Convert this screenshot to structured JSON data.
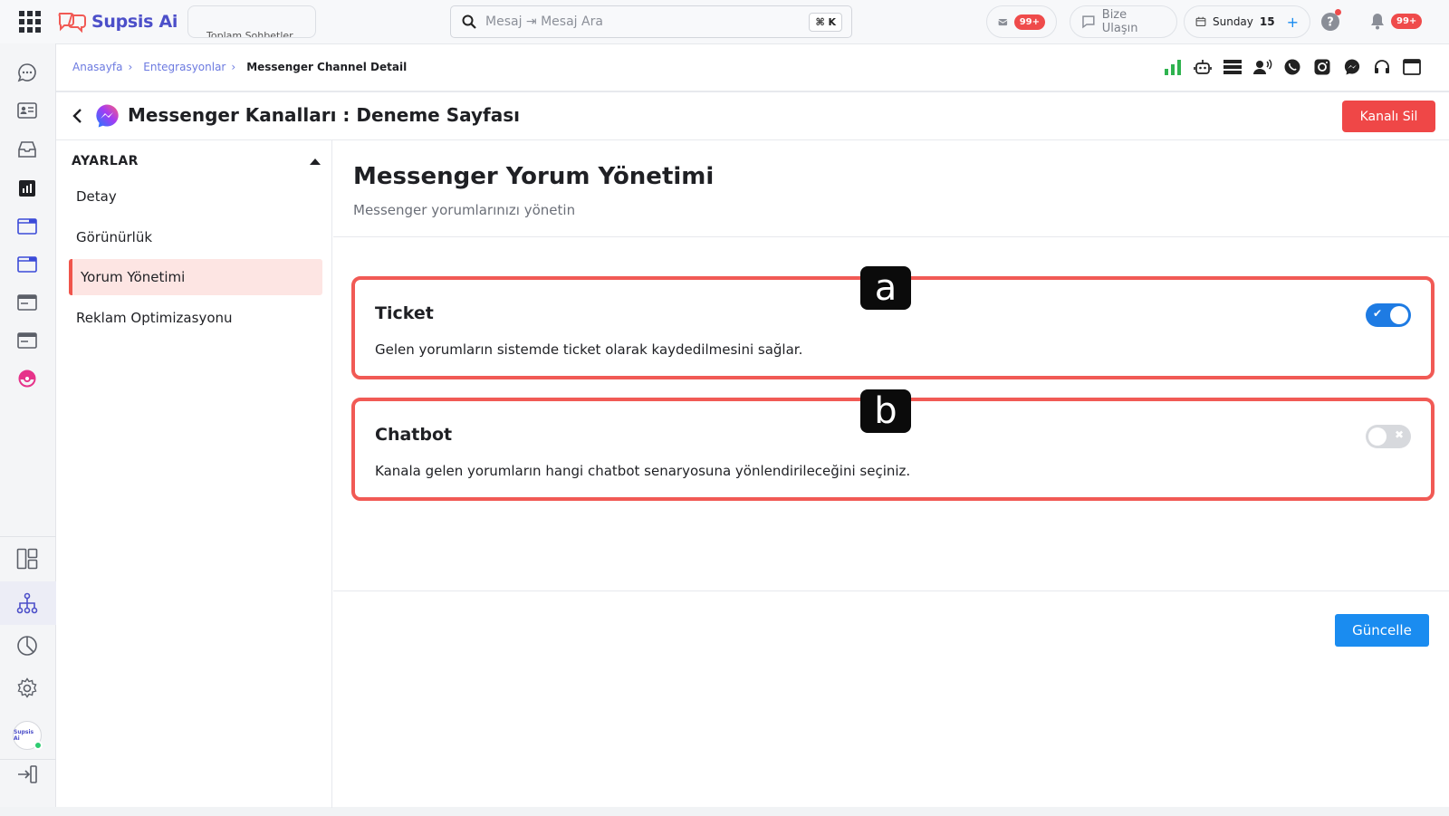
{
  "app": {
    "logo_text": "Supsis Ai"
  },
  "topbar": {
    "chats_label": "Toplam Sohbetler",
    "search_placeholder": "Mesaj ⇥ Mesaj Ara",
    "shortcut": "⌘ K",
    "mail_badge": "99+",
    "contact_label": "Bize Ulaşın",
    "day_label": "Sunday",
    "day_number": "15",
    "notif_badge": "99+"
  },
  "breadcrumb": {
    "items": [
      "Anasayfa",
      "Entegrasyonlar"
    ],
    "current": "Messenger Channel Detail"
  },
  "header": {
    "title": "Messenger Kanalları : Deneme Sayfası",
    "delete_label": "Kanalı Sil"
  },
  "settings": {
    "heading": "AYARLAR",
    "items": [
      {
        "label": "Detay"
      },
      {
        "label": "Görünürlük"
      },
      {
        "label": "Yorum Yönetimi",
        "active": true
      },
      {
        "label": "Reklam Optimizasyonu"
      }
    ]
  },
  "section": {
    "title": "Messenger Yorum Yönetimi",
    "subtitle": "Messenger yorumlarınızı yönetin"
  },
  "options": [
    {
      "marker": "a",
      "title": "Ticket",
      "description": "Gelen yorumların sistemde ticket olarak kaydedilmesini sağlar.",
      "enabled": true
    },
    {
      "marker": "b",
      "title": "Chatbot",
      "description": "Kanala gelen yorumların hangi chatbot senaryosuna yönlendirileceğini seçiniz.",
      "enabled": false
    }
  ],
  "update_label": "Güncelle",
  "rail_avatar_text": "Supsis Ai",
  "colors": {
    "accent": "#1a8cf0",
    "danger": "#ef4747",
    "highlight": "#f15a55",
    "brand": "#4c4fc9"
  }
}
